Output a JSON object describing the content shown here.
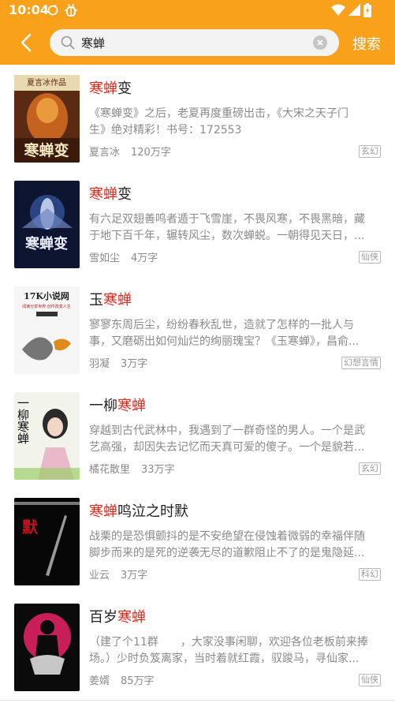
{
  "status_bar": {
    "time": "10:04",
    "icons": [
      "sync-icon",
      "bug-icon",
      "wifi-icon",
      "signal-icon",
      "battery-icon"
    ]
  },
  "colors": {
    "accent": "#f9a11b",
    "highlight": "#e8261a",
    "text_primary": "#222222",
    "text_secondary": "#8a8a8a"
  },
  "search": {
    "value": "寒蝉",
    "button_label": "搜索"
  },
  "books": [
    {
      "title_parts": [
        "",
        "寒蝉",
        "变"
      ],
      "desc_lines": [
        "《寒蝉变》之后，老夏再度重磅出击，《大宋之天子门",
        "生》绝对精彩！书号：172553"
      ],
      "author": "夏言冰",
      "words": "120万字",
      "tag": "玄幻",
      "cover_texts": [
        "夏言冰作品",
        "寒蝉变"
      ]
    },
    {
      "title_parts": [
        "",
        "寒蝉",
        "变"
      ],
      "desc_lines": [
        "有六足双翅善鸣者遁于飞雪崖，不畏风寒，不畏黑暗，藏",
        "于地下百千年，辗转风尘，数次蝉蜕。一朝得见天日，..."
      ],
      "author": "雪如尘",
      "words": "4万字",
      "tag": "仙侠",
      "cover_texts": [
        "寒蝉变"
      ]
    },
    {
      "title_parts": [
        "玉",
        "寒蝉",
        ""
      ],
      "desc_lines": [
        "寥寥东周后尘，纷纷春秋乱世，造就了怎样的一批人与",
        "事，又磨砺出如何灿烂的绚丽瑰宝？《玉寒蝉》，昌俞..."
      ],
      "author": "羽凝",
      "words": "3万字",
      "tag": "幻想言情",
      "cover_texts": [
        "17K小说网",
        "阅读分享世界 创作改变人生"
      ]
    },
    {
      "title_parts": [
        "一柳",
        "寒蝉",
        ""
      ],
      "desc_lines": [
        "穿越到古代武林中，我遇到了一群奇怪的男人。一个是武",
        "艺高强，却因失去记忆而天真可爱的傻子。一个是貌若..."
      ],
      "author": "橘花散里",
      "words": "33万字",
      "tag": "玄幻",
      "cover_texts": [
        "一柳寒蝉"
      ]
    },
    {
      "title_parts": [
        "",
        "寒蝉",
        "鸣泣之时默"
      ],
      "desc_lines": [
        "战栗的是恐惧颤抖的是不安绝望在侵蚀着微弱的幸福伴随",
        "脚步而来的是死的逆袭无尽的道歉阻止不了的是鬼隐延..."
      ],
      "author": "业云",
      "words": "3万字",
      "tag": "科幻",
      "cover_texts": [
        "默"
      ]
    },
    {
      "title_parts": [
        "百岁",
        "寒蝉",
        ""
      ],
      "desc_lines": [
        "（建了个11群　　，大家没事闲聊，欢迎各位老板前来捧",
        "场。）少时负笈离家，当时着就红霞，驭踆马，寻仙家..."
      ],
      "author": "姜婿",
      "words": "85万字",
      "tag": "仙侠",
      "cover_texts": []
    }
  ]
}
